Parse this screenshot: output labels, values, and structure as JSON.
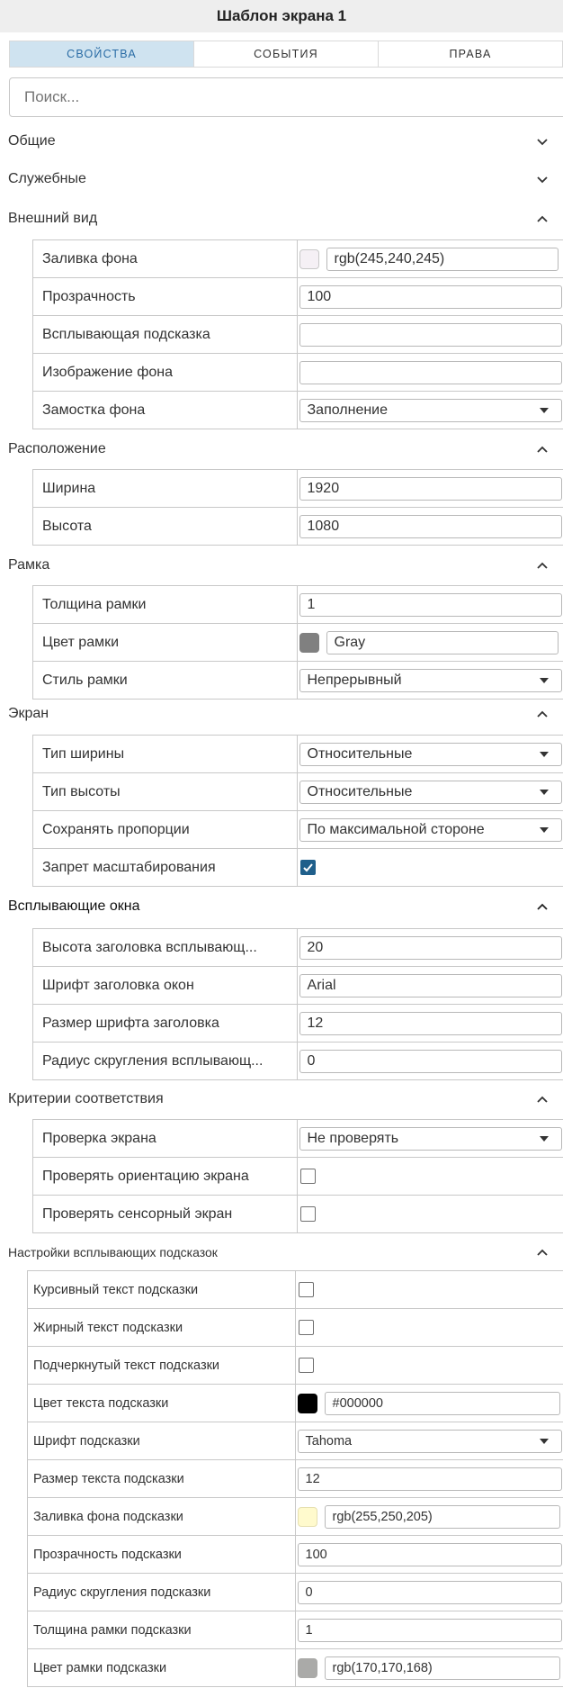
{
  "header": {
    "title": "Шаблон экрана 1"
  },
  "tabs": [
    {
      "label": "СВОЙСТВА",
      "active": true
    },
    {
      "label": "СОБЫТИЯ",
      "active": false
    },
    {
      "label": "ПРАВА",
      "active": false
    }
  ],
  "search": {
    "placeholder": "Поиск..."
  },
  "colors": {
    "active_tab_bg": "#cfe3f0",
    "active_tab_text": "#2a6ca5",
    "checkbox_checked": "#1f5f8b"
  },
  "sections": {
    "general": {
      "title": "Общие",
      "expanded": false
    },
    "service": {
      "title": "Служебные",
      "expanded": false
    },
    "appearance": {
      "title": "Внешний вид",
      "expanded": true,
      "background_fill": {
        "label": "Заливка фона",
        "value": "rgb(245,240,245)",
        "swatch": "#f5f0f5"
      },
      "opacity": {
        "label": "Прозрачность",
        "value": "100"
      },
      "tooltip": {
        "label": "Всплывающая подсказка",
        "value": ""
      },
      "background_image": {
        "label": "Изображение фона",
        "value": ""
      },
      "background_tiling": {
        "label": "Замостка фона",
        "value": "Заполнение"
      }
    },
    "position": {
      "title": "Расположение",
      "expanded": true,
      "width": {
        "label": "Ширина",
        "value": "1920"
      },
      "height": {
        "label": "Высота",
        "value": "1080"
      }
    },
    "border": {
      "title": "Рамка",
      "expanded": true,
      "thickness": {
        "label": "Толщина рамки",
        "value": "1"
      },
      "color": {
        "label": "Цвет рамки",
        "value": "Gray",
        "swatch": "#808080"
      },
      "style": {
        "label": "Стиль рамки",
        "value": "Непрерывный"
      }
    },
    "screen": {
      "title": "Экран",
      "expanded": true,
      "width_type": {
        "label": "Тип ширины",
        "value": "Относительные"
      },
      "height_type": {
        "label": "Тип высоты",
        "value": "Относительные"
      },
      "keep_proportions": {
        "label": "Сохранять пропорции",
        "value": "По максимальной стороне"
      },
      "disable_scaling": {
        "label": "Запрет масштабирования",
        "checked": true
      }
    },
    "popups": {
      "title": "Всплывающие окна",
      "expanded": true,
      "header_height": {
        "label": "Высота заголовка всплывающ...",
        "value": "20"
      },
      "header_font": {
        "label": "Шрифт заголовка окон",
        "value": "Arial"
      },
      "header_font_size": {
        "label": "Размер шрифта заголовка",
        "value": "12"
      },
      "corner_radius": {
        "label": "Радиус скругления всплывающ...",
        "value": "0"
      }
    },
    "criteria": {
      "title": "Критерии соответствия",
      "expanded": true,
      "screen_check": {
        "label": "Проверка экрана",
        "value": "Не проверять"
      },
      "check_orientation": {
        "label": "Проверять ориентацию экрана",
        "checked": false
      },
      "check_touch": {
        "label": "Проверять сенсорный экран",
        "checked": false
      }
    },
    "tooltip_settings": {
      "title": "Настройки всплывающих подсказок",
      "expanded": true,
      "italic": {
        "label": "Курсивный текст подсказки",
        "checked": false
      },
      "bold": {
        "label": "Жирный текст подсказки",
        "checked": false
      },
      "underline": {
        "label": "Подчеркнутый текст подсказки",
        "checked": false
      },
      "text_color": {
        "label": "Цвет текста подсказки",
        "value": "#000000",
        "swatch": "#000000"
      },
      "font": {
        "label": "Шрифт подсказки",
        "value": "Tahoma"
      },
      "text_size": {
        "label": "Размер текста подсказки",
        "value": "12"
      },
      "fill": {
        "label": "Заливка фона подсказки",
        "value": "rgb(255,250,205)",
        "swatch": "#fffacd"
      },
      "opacity": {
        "label": "Прозрачность подсказки",
        "value": "100"
      },
      "radius": {
        "label": "Радиус скругления подсказки",
        "value": "0"
      },
      "border_thickness": {
        "label": "Толщина рамки подсказки",
        "value": "1"
      },
      "border_color": {
        "label": "Цвет рамки подсказки",
        "value": "rgb(170,170,168)",
        "swatch": "#aaaaa8"
      }
    }
  }
}
